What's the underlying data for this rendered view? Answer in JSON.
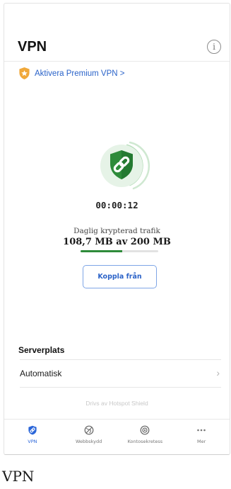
{
  "header": {
    "title": "VPN",
    "info_icon": "info-icon"
  },
  "premium": {
    "label": "Aktivera Premium VPN >",
    "icon": "star-shield-icon",
    "color": "#f0a83a"
  },
  "status": {
    "icon": "link-shield-icon",
    "accent": "#2e8b3a",
    "timer": "00:00:12",
    "traffic_label": "Daglig krypterad trafik",
    "traffic_value": "108,7 MB av 200 MB",
    "traffic_fraction": 0.54
  },
  "disconnect_label": "Koppla från",
  "server": {
    "section_title": "Serverplats",
    "location": "Automatisk",
    "chevron": "›"
  },
  "powered_by": "Drivs av Hotspot Shield",
  "tabs": [
    {
      "label": "VPN",
      "icon": "shield-icon",
      "active": true
    },
    {
      "label": "Webbskydd",
      "icon": "globe-block-icon",
      "active": false
    },
    {
      "label": "Kontosekretess",
      "icon": "eye-icon",
      "active": false
    },
    {
      "label": "Mer",
      "icon": "more-icon",
      "active": false
    }
  ],
  "caption": "VPN"
}
